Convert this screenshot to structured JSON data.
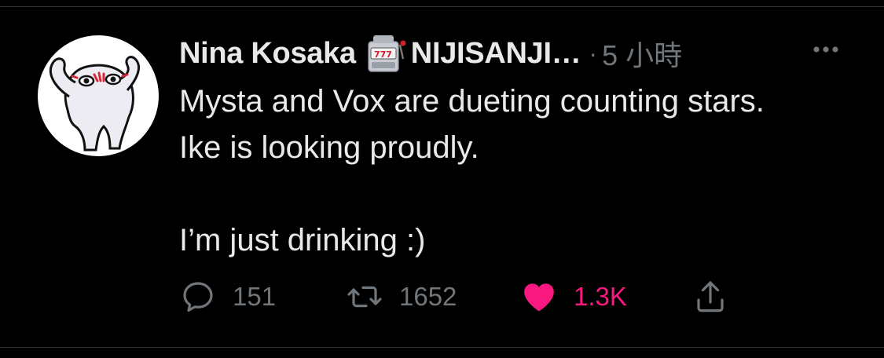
{
  "tweet": {
    "display_name": "Nina Kosaka",
    "name_emoji": "slot-machine-icon",
    "display_name_suffix": "NIJISANJI…",
    "separator": "·",
    "timestamp": "5 小時",
    "text_lines": [
      "Mysta and Vox are dueting counting stars.",
      "Ike is looking proudly.",
      "",
      "I’m just drinking :)"
    ]
  },
  "actions": {
    "reply_count": "151",
    "retweet_count": "1652",
    "like_count": "1.3K"
  },
  "colors": {
    "background": "#000000",
    "text": "#e7e9ea",
    "secondary": "#71767b",
    "like": "#f91880",
    "divider": "#2f3336"
  }
}
